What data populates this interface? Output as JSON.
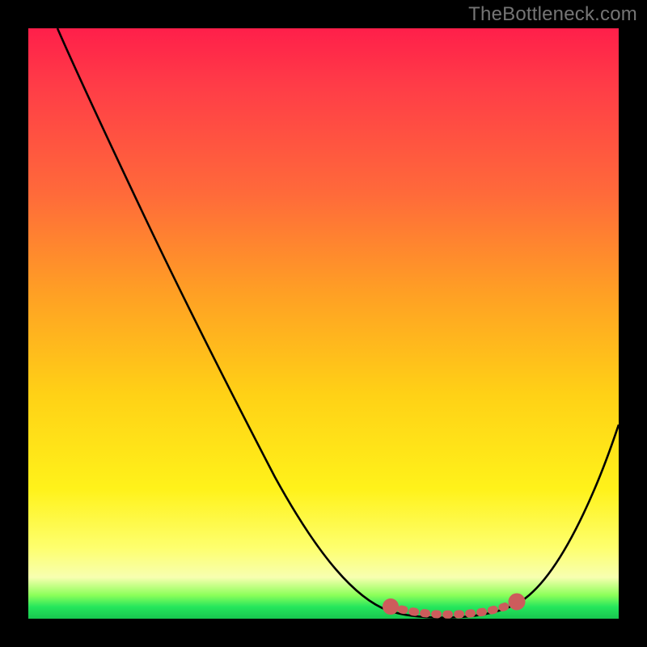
{
  "attribution": "TheBottleneck.com",
  "chart_data": {
    "type": "line",
    "title": "",
    "xlabel": "",
    "ylabel": "",
    "xlim": [
      0,
      100
    ],
    "ylim": [
      0,
      100
    ],
    "grid": false,
    "legend": false,
    "series": [
      {
        "name": "bottleneck-curve",
        "color": "#000000",
        "x": [
          5,
          10,
          15,
          20,
          25,
          30,
          35,
          40,
          45,
          50,
          55,
          60,
          63,
          66,
          70,
          74,
          78,
          82,
          86,
          90,
          95,
          100
        ],
        "y": [
          100,
          92,
          83,
          74,
          65,
          56,
          47,
          38,
          29,
          20,
          12,
          5,
          2,
          1,
          0,
          0,
          0,
          1,
          3,
          8,
          17,
          30
        ]
      },
      {
        "name": "optimal-range-marker",
        "color": "#cd5c5c",
        "x": [
          63,
          66,
          69,
          72,
          75,
          78,
          81,
          83
        ],
        "y": [
          2,
          1,
          0.6,
          0.4,
          0.4,
          0.6,
          1,
          1.8
        ]
      }
    ],
    "gradient_stops": [
      {
        "pct": 0,
        "color": "#ff1f4a"
      },
      {
        "pct": 10,
        "color": "#ff3d47"
      },
      {
        "pct": 28,
        "color": "#ff6a3a"
      },
      {
        "pct": 45,
        "color": "#ffa024"
      },
      {
        "pct": 62,
        "color": "#ffd116"
      },
      {
        "pct": 78,
        "color": "#fff21a"
      },
      {
        "pct": 88,
        "color": "#feff6e"
      },
      {
        "pct": 93,
        "color": "#f7ffb0"
      },
      {
        "pct": 96,
        "color": "#8dff5a"
      },
      {
        "pct": 98,
        "color": "#25e65c"
      },
      {
        "pct": 100,
        "color": "#18c74f"
      }
    ]
  }
}
